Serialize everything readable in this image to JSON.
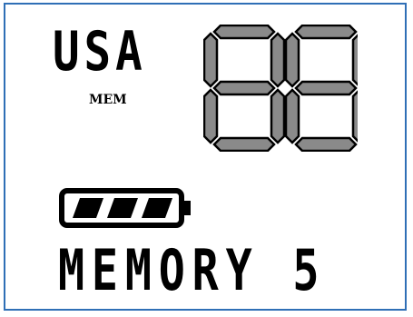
{
  "display": {
    "region_label": "USA",
    "mem_label": "MEM",
    "memory_label": "MEMORY 5"
  },
  "digits": {
    "value": "88",
    "segment_color": "#8a8a8a",
    "segment_outline": "#000000"
  },
  "battery": {
    "level": 3,
    "max": 3
  },
  "colors": {
    "frame": "#2f6fb6",
    "ink": "#000000"
  }
}
